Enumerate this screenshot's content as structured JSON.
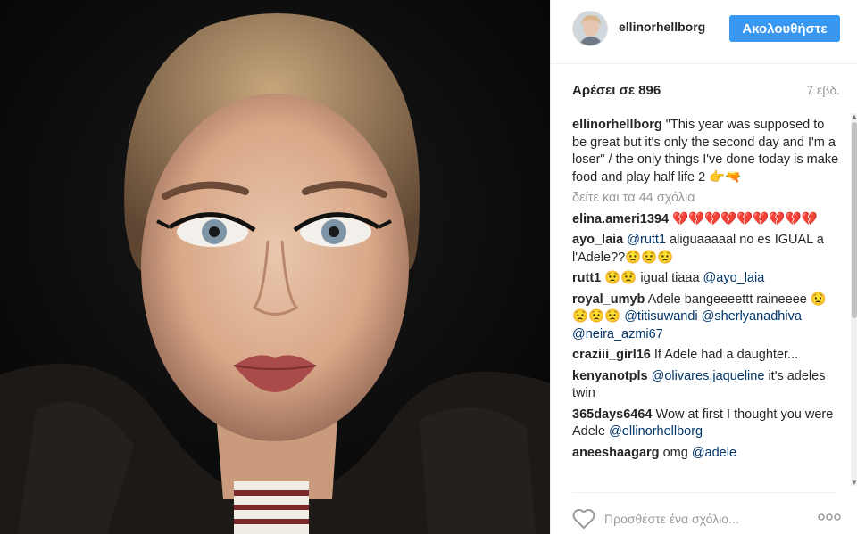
{
  "post": {
    "username": "ellinorhellborg",
    "follow_label": "Ακολουθήστε",
    "likes_label": "Αρέσει σε 896",
    "time_label": "7 εβδ.",
    "caption": {
      "user": "ellinorhellborg",
      "text": "\"This year was supposed to be great but it's only the second day and I'm a loser\" / the only things I've done today is make food and play half life 2 👉🔫"
    },
    "view_all_label": "δείτε και τα 44 σχόλια",
    "comments": [
      {
        "user": "elina.ameri1394",
        "text": "💔💔💔💔💔💔💔💔💔"
      },
      {
        "user": "ayo_laia",
        "mention1": "@rutt1",
        "text": "aliguaaaaal no es IGUAL a l'Adele??😟😟😟"
      },
      {
        "user": "rutt1",
        "text": "😟😟 igual tiaaa",
        "mention1": "@ayo_laia"
      },
      {
        "user": "royal_umyb",
        "text": "Adele bangeeeettt raineeee 😟😟😟😟",
        "mention1": "@titisuwandi",
        "mention2": "@sherlyanadhiva",
        "mention3": "@neira_azmi67"
      },
      {
        "user": "craziii_girl16",
        "text": "If Adele had a daughter..."
      },
      {
        "user": "kenyanotpls",
        "mention1": "@olivares.jaqueline",
        "text": "it's adeles twin"
      },
      {
        "user": "365days6464",
        "text": "Wow at first I thought you were Adele",
        "mention1": "@ellinorhellborg"
      },
      {
        "user": "aneeshaagarg",
        "text": "omg",
        "mention1": "@adele"
      }
    ],
    "comment_placeholder": "Προσθέστε ένα σχόλιο...",
    "icons": {
      "like": "heart-outline-icon",
      "more": "more-options-icon"
    },
    "colors": {
      "follow_button": "#3897f0",
      "mention": "#003569",
      "muted": "#999999"
    }
  }
}
